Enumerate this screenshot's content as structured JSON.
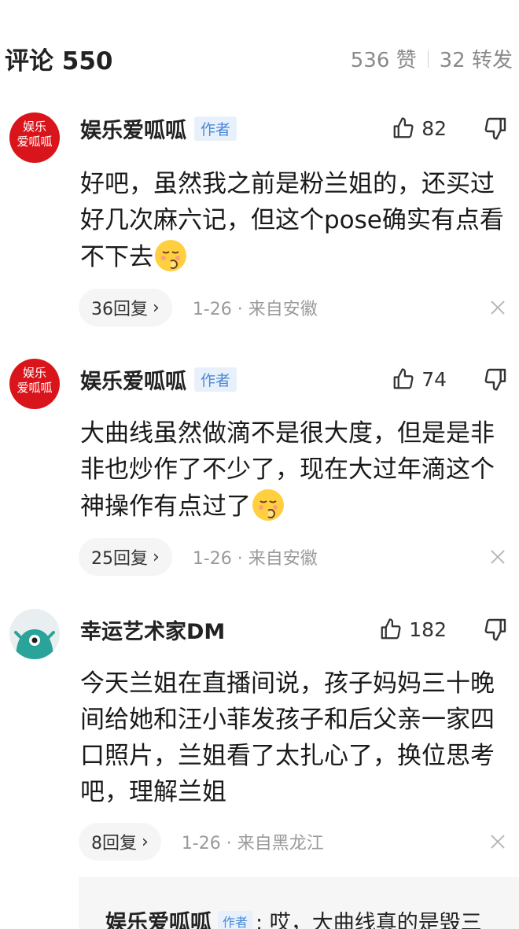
{
  "header": {
    "title": "评论 550",
    "likes": "536 赞",
    "reposts": "32 转发"
  },
  "comments": [
    {
      "user": "娱乐爱呱呱",
      "badge": "作者",
      "avatar_text": "娱乐 爱呱呱",
      "likes": "82",
      "text": "好吧，虽然我之前是粉兰姐的，还买过好几次麻六记，但这个pose确实有点看不下去",
      "replies": "36回复",
      "meta": "1-26 · 来自安徽"
    },
    {
      "user": "娱乐爱呱呱",
      "badge": "作者",
      "avatar_text": "娱乐 爱呱呱",
      "likes": "74",
      "text": "大曲线虽然做滴不是很大度，但是是非非也炒作了不少了，现在大过年滴这个神操作有点过了",
      "replies": "25回复",
      "meta": "1-26 · 来自安徽"
    },
    {
      "user": "幸运艺术家DM",
      "likes": "182",
      "text": "今天兰姐在直播间说，孩子妈妈三十晚间给她和汪小菲发孩子和后父亲一家四口照片，兰姐看了太扎心了，换位思考吧，理解兰姐",
      "replies": "8回复",
      "meta": "1-26 · 来自黑龙江"
    }
  ],
  "sub_reply": {
    "user": "娱乐爱呱呱",
    "badge": "作者",
    "text": ": 哎，大曲线真的是毁三"
  }
}
